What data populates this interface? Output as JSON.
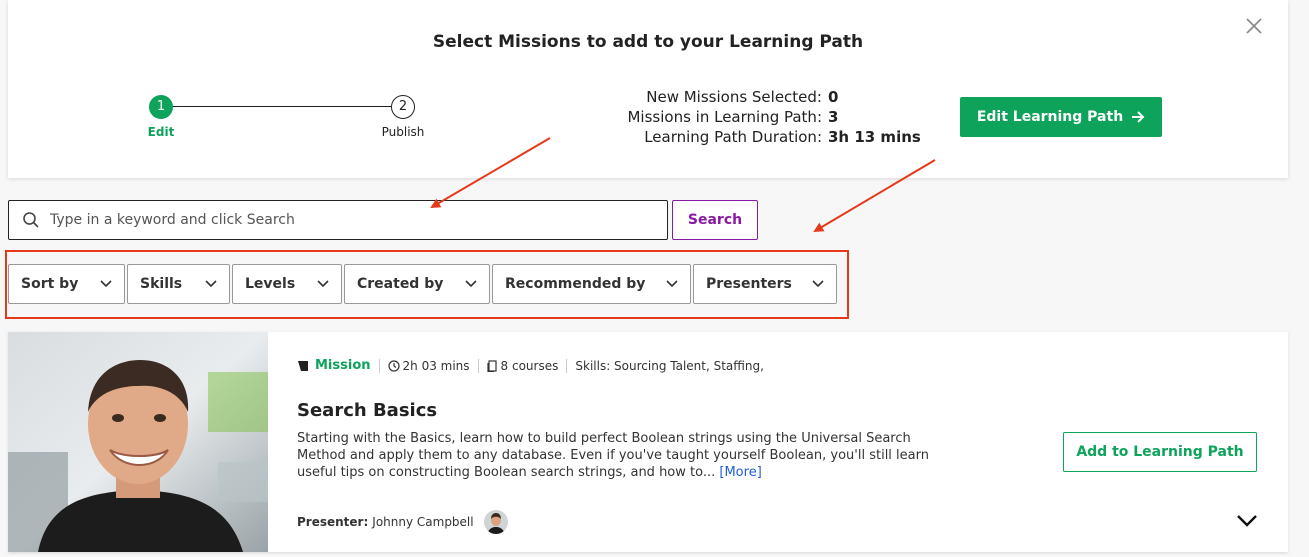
{
  "dialog": {
    "title": "Select Missions to add to your Learning Path"
  },
  "stepper": {
    "steps": [
      {
        "number": "1",
        "label": "Edit"
      },
      {
        "number": "2",
        "label": "Publish"
      }
    ]
  },
  "stats": {
    "new_selected_label": "New Missions Selected:",
    "new_selected_value": "0",
    "in_path_label": "Missions in Learning Path:",
    "in_path_value": "3",
    "duration_label": "Learning Path Duration:",
    "duration_value": "3h 13 mins"
  },
  "edit_button": {
    "label": "Edit Learning Path"
  },
  "search": {
    "placeholder": "Type in a keyword and click Search",
    "button_label": "Search"
  },
  "filters": [
    {
      "label": "Sort by"
    },
    {
      "label": "Skills"
    },
    {
      "label": "Levels"
    },
    {
      "label": "Created by"
    },
    {
      "label": "Recommended by"
    },
    {
      "label": "Presenters"
    }
  ],
  "card": {
    "type_label": "Mission",
    "duration": "2h 03 mins",
    "courses": "8 courses",
    "skills": "Skills: Sourcing Talent, Staffing,",
    "title": "Search Basics",
    "description": "Starting with the Basics, learn how to build perfect Boolean strings using the Universal Search Method and apply them to any database. Even if you've taught yourself Boolean, you'll still learn useful tips on constructing Boolean search strings, and how to...",
    "more_label": "[More]",
    "presenter_label": "Presenter:",
    "presenter_name": "Johnny Campbell",
    "add_button_label": "Add to Learning Path"
  },
  "colors": {
    "accent_green": "#0ea35a",
    "search_purple": "#8a1aa5",
    "annotation_red": "#e6391a",
    "link_blue": "#1f5fd6"
  }
}
